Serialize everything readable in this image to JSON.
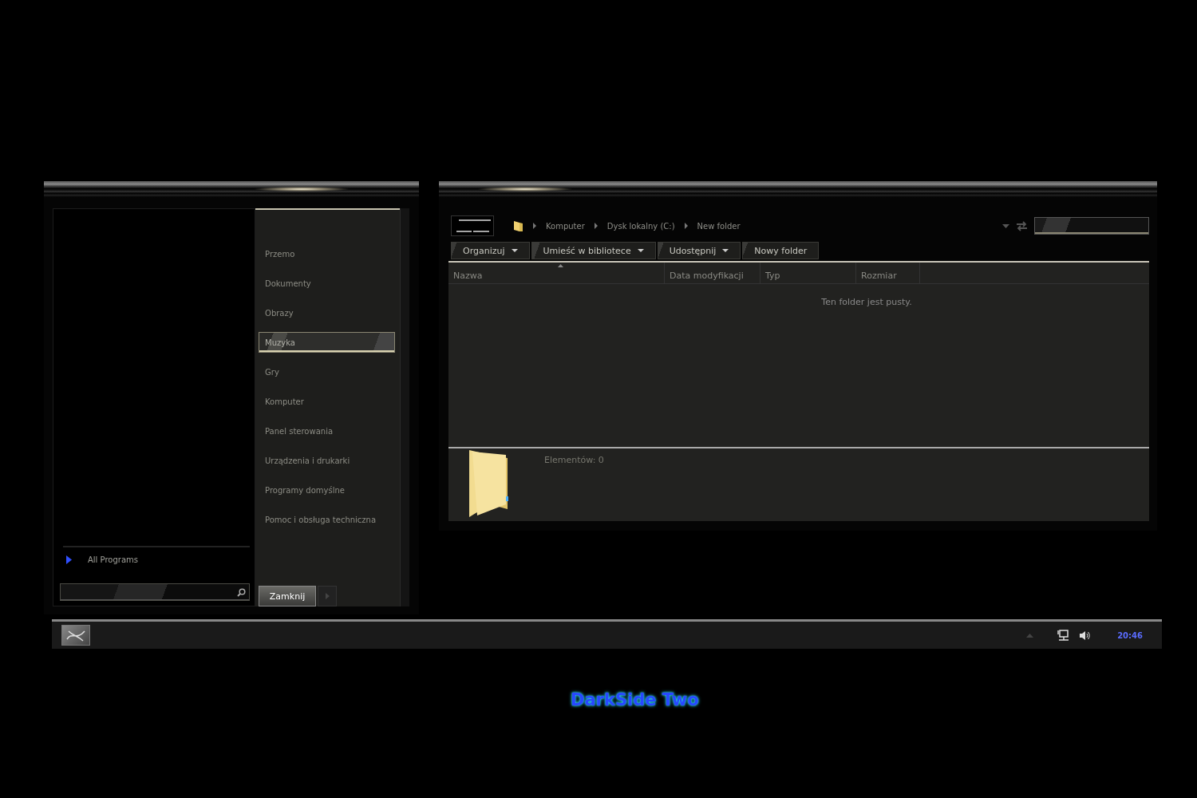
{
  "start_menu": {
    "places": [
      {
        "label": "Przemo",
        "selected": false
      },
      {
        "label": "Dokumenty",
        "selected": false
      },
      {
        "label": "Obrazy",
        "selected": false
      },
      {
        "label": "Muzyka",
        "selected": true
      },
      {
        "label": "Gry",
        "selected": false
      },
      {
        "label": "Komputer",
        "selected": false
      },
      {
        "label": "Panel sterowania",
        "selected": false
      },
      {
        "label": "Urządzenia i drukarki",
        "selected": false
      },
      {
        "label": "Programy domyślne",
        "selected": false
      },
      {
        "label": "Pomoc i obsługa techniczna",
        "selected": false
      }
    ],
    "all_programs": "All Programs",
    "shutdown_button": "Zamknij"
  },
  "explorer": {
    "breadcrumb": [
      "Komputer",
      "Dysk lokalny (C:)",
      "New folder"
    ],
    "toolbar": [
      {
        "label": "Organizuj",
        "dropdown": true
      },
      {
        "label": "Umieść w bibliotece",
        "dropdown": true
      },
      {
        "label": "Udostępnij",
        "dropdown": true
      },
      {
        "label": "Nowy folder",
        "dropdown": false
      }
    ],
    "columns": [
      "Nazwa",
      "Data modyfikacji",
      "Typ",
      "Rozmiar"
    ],
    "empty_message": "Ten folder jest pusty.",
    "details": "Elementów: 0"
  },
  "taskbar": {
    "clock": "20:46"
  },
  "caption": "DarkSide Two"
}
